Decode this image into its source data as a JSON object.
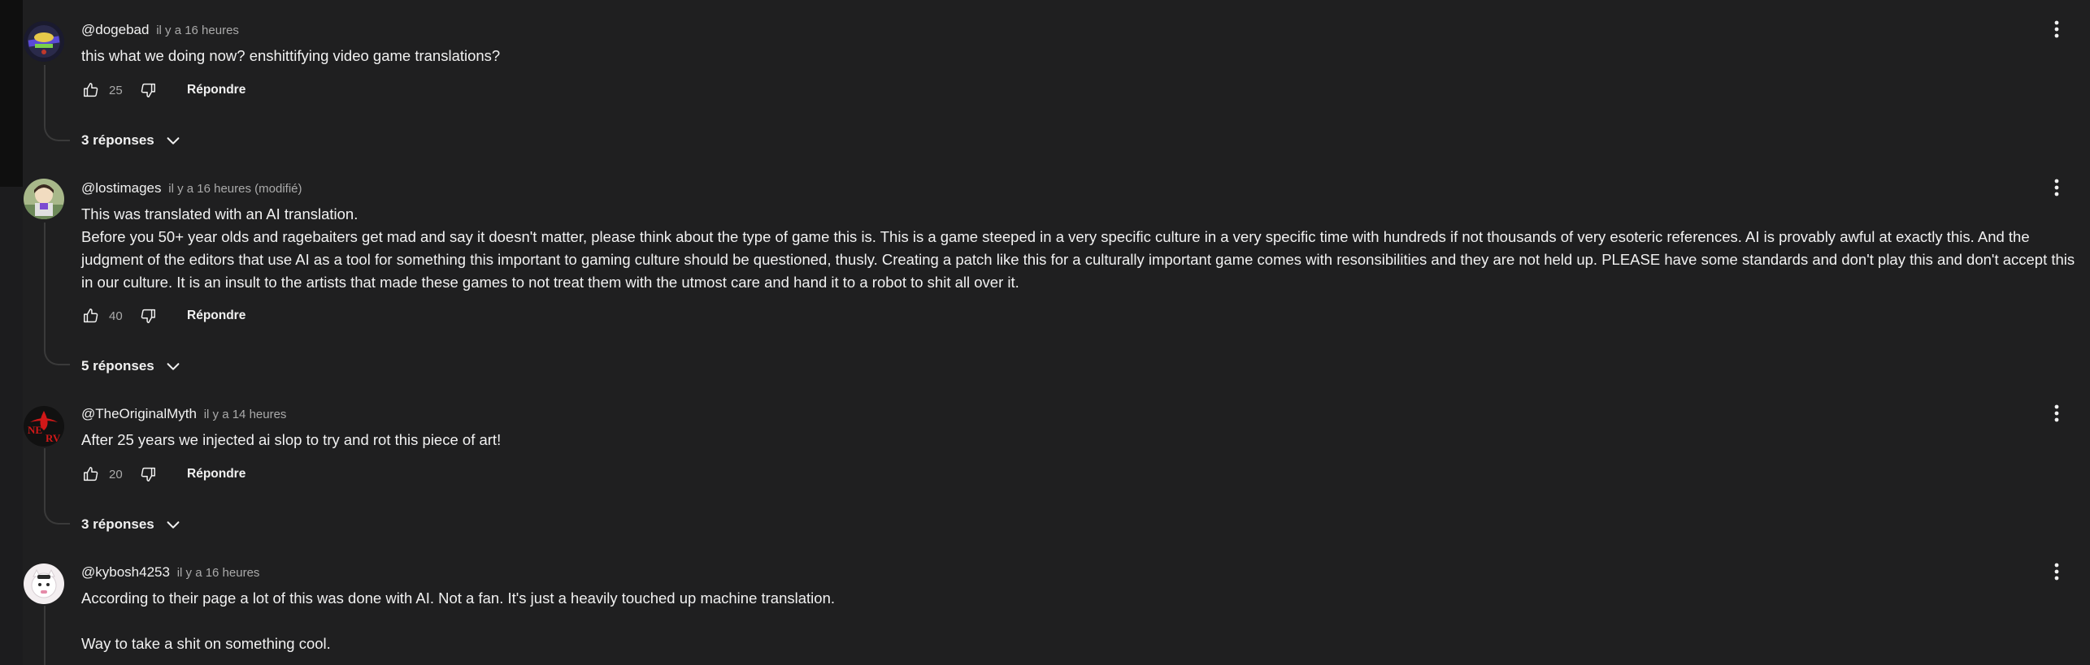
{
  "comments": [
    {
      "author": "@dogebad",
      "time": "il y a 16 heures",
      "lines": [
        "this what we doing now? enshittifying video game translations?"
      ],
      "likes": "25",
      "reply_label": "Répondre",
      "replies_label": "3 réponses",
      "avatar_icon": "crossed-logo-avatar"
    },
    {
      "author": "@lostimages",
      "time": "il y a 16 heures (modifié)",
      "lines": [
        "This was translated with an AI translation.",
        "Before you 50+ year olds and ragebaiters get mad and say it doesn't matter, please think about the type of game this is. This is a game steeped in a very specific culture in a very specific time with hundreds if not thousands of very esoteric references. AI is provably awful at exactly this. And the judgment of the editors that use AI as a tool for something this important to gaming culture should be questioned, thusly. Creating a patch like this for a culturally important game comes with resonsibilities and they are not held up. PLEASE have some standards and don't play this and don't accept this in our culture. It is an insult to the artists that made these games to not treat them with the utmost care and hand it to a robot to shit all over it."
      ],
      "likes": "40",
      "reply_label": "Répondre",
      "replies_label": "5 réponses",
      "avatar_icon": "anime-character-avatar"
    },
    {
      "author": "@TheOriginalMyth",
      "time": "il y a 14 heures",
      "lines": [
        "After 25 years we injected ai slop to try and rot this piece of art!"
      ],
      "likes": "20",
      "reply_label": "Répondre",
      "replies_label": "3 réponses",
      "avatar_icon": "nerv-logo-avatar"
    },
    {
      "author": "@kybosh4253",
      "time": "il y a 16 heures",
      "lines": [
        "According to their page a lot of this was done with AI. Not a fan. It's just a heavily touched up machine translation.",
        "",
        "Way to take a shit on something cool."
      ],
      "avatar_icon": "white-cat-avatar"
    }
  ],
  "colors": {
    "background": "#1f1f20",
    "text": "#f1f1f1",
    "secondary_text": "#aaaaaa",
    "thread_line": "#3a3a3a"
  }
}
